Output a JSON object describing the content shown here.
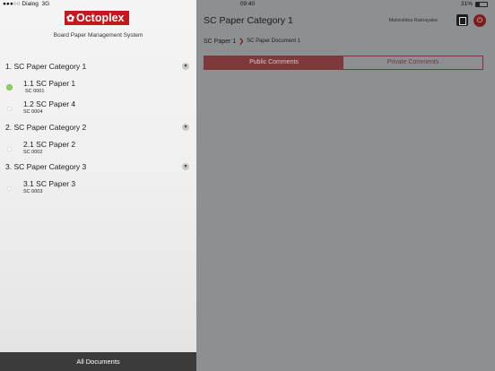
{
  "status_bar": {
    "carrier": "●●●○○ Dialog",
    "network": "3G",
    "time": "09:40",
    "battery": "31%"
  },
  "drawer": {
    "logo": "Octoplex",
    "subtitle": "Board Paper Management System",
    "categories": [
      {
        "title": "1. SC Paper Category 1",
        "papers": [
          {
            "title": "1.1 SC Paper 1",
            "code": "SC 0001"
          },
          {
            "title": "1.2 SC Paper 4",
            "code": "SC 0004"
          }
        ]
      },
      {
        "title": "2. SC Paper Category 2",
        "papers": [
          {
            "title": "2.1 SC Paper 2",
            "code": "SC 0002"
          }
        ]
      },
      {
        "title": "3. SC Paper Category 3",
        "papers": [
          {
            "title": "3.1 SC Paper 3",
            "code": "SC 0003"
          }
        ]
      }
    ],
    "all_documents": "All Documents"
  },
  "main": {
    "title": "SC Paper Category 1",
    "user_name": "Maheshika Ratnayake",
    "breadcrumb": {
      "parent": "SC Paper 1",
      "current": "SC Paper Document 1"
    },
    "tabs": {
      "public": "Public Comments",
      "private": "Private Comments"
    }
  },
  "colors": {
    "brand": "#c4171e",
    "drawer_bg": "#f2f2f2",
    "overlay": "#8d9093",
    "footer": "#3b3b3c",
    "active_dot": "#8fd35f"
  }
}
